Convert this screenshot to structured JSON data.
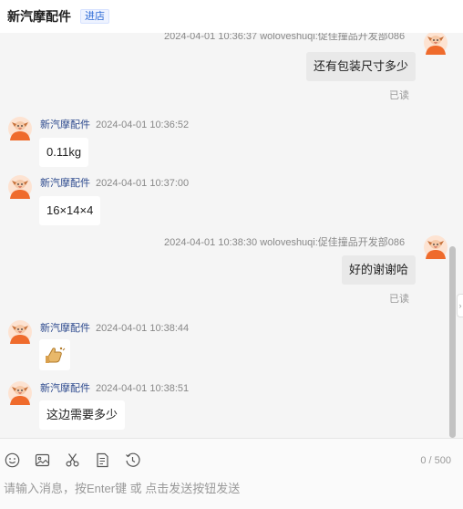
{
  "header": {
    "shop_name": "新汽摩配件",
    "enter_store": "进店"
  },
  "messages": [
    {
      "side": "right",
      "meta": "2024-04-01 10:36:37   woloveshuqi:促佳撞品开发部086",
      "text": "还有包装尺寸多少",
      "status": "已读"
    },
    {
      "side": "left",
      "nick": "新汽摩配件",
      "time": "2024-04-01 10:36:52",
      "text": "0.11kg"
    },
    {
      "side": "left",
      "nick": "新汽摩配件",
      "time": "2024-04-01 10:37:00",
      "text": "16×14×4"
    },
    {
      "side": "right",
      "meta": "2024-04-01 10:38:30   woloveshuqi:促佳撞品开发部086",
      "text": "好的谢谢哈",
      "status": "已读"
    },
    {
      "side": "left",
      "nick": "新汽摩配件",
      "time": "2024-04-01 10:38:44",
      "emoji": "thumbs-up-sticker"
    },
    {
      "side": "left",
      "nick": "新汽摩配件",
      "time": "2024-04-01 10:38:51",
      "text": "这边需要多少"
    }
  ],
  "composer": {
    "tools": [
      "smiley-icon",
      "image-icon",
      "scissors-icon",
      "document-icon",
      "history-icon"
    ],
    "counter": "0 / 500",
    "placeholder": "请输入消息，按Enter键 或 点击发送按钮发送"
  }
}
